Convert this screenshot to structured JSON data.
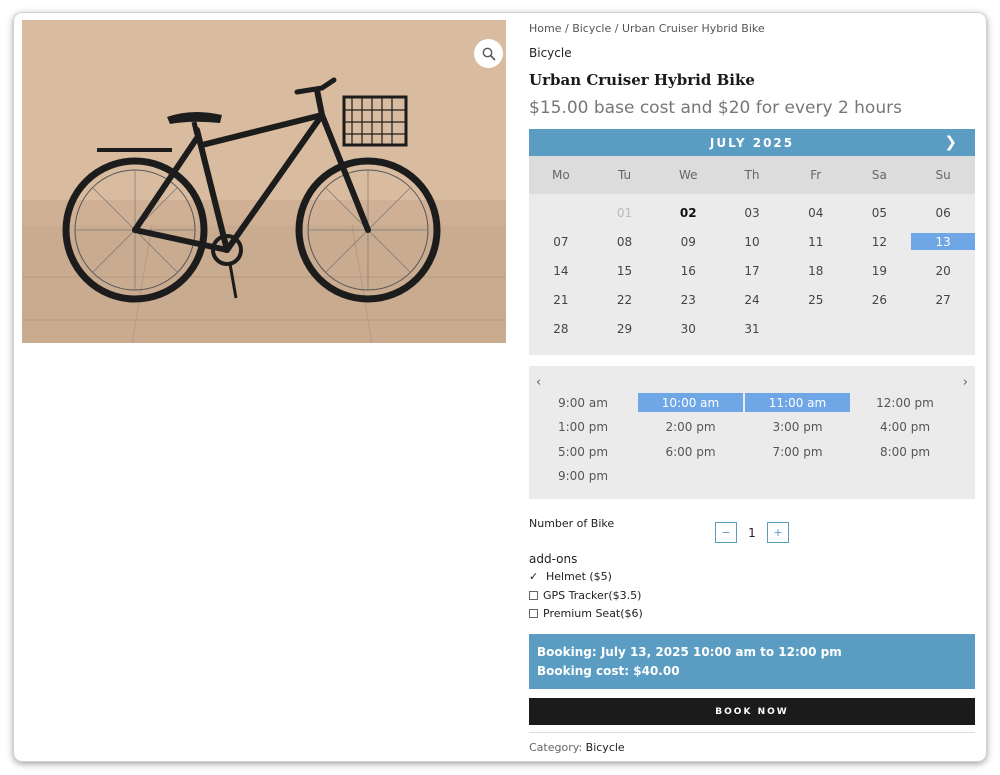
{
  "breadcrumb": {
    "home": "Home",
    "sep1": " / ",
    "category": "Bicycle",
    "sep2": " / ",
    "current": "Urban Cruiser Hybrid Bike"
  },
  "product": {
    "category_label": "Bicycle",
    "title": "Urban Cruiser Hybrid Bike",
    "price_text": "$15.00 base cost and $20 for every 2 hours"
  },
  "calendar": {
    "month": "JULY 2025",
    "next_icon": "chevron-right-icon",
    "weekdays": [
      "Mo",
      "Tu",
      "We",
      "Th",
      "Fr",
      "Sa",
      "Su"
    ],
    "days": [
      {
        "label": "",
        "state": "blank"
      },
      {
        "label": "01",
        "state": "off"
      },
      {
        "label": "02",
        "state": "today"
      },
      {
        "label": "03",
        "state": "normal"
      },
      {
        "label": "04",
        "state": "normal"
      },
      {
        "label": "05",
        "state": "normal"
      },
      {
        "label": "06",
        "state": "normal"
      },
      {
        "label": "07",
        "state": "normal"
      },
      {
        "label": "08",
        "state": "normal"
      },
      {
        "label": "09",
        "state": "normal"
      },
      {
        "label": "10",
        "state": "normal"
      },
      {
        "label": "11",
        "state": "normal"
      },
      {
        "label": "12",
        "state": "normal"
      },
      {
        "label": "13",
        "state": "selected"
      },
      {
        "label": "14",
        "state": "normal"
      },
      {
        "label": "15",
        "state": "normal"
      },
      {
        "label": "16",
        "state": "normal"
      },
      {
        "label": "17",
        "state": "normal"
      },
      {
        "label": "18",
        "state": "normal"
      },
      {
        "label": "19",
        "state": "normal"
      },
      {
        "label": "20",
        "state": "normal"
      },
      {
        "label": "21",
        "state": "normal"
      },
      {
        "label": "22",
        "state": "normal"
      },
      {
        "label": "23",
        "state": "normal"
      },
      {
        "label": "24",
        "state": "normal"
      },
      {
        "label": "25",
        "state": "normal"
      },
      {
        "label": "26",
        "state": "normal"
      },
      {
        "label": "27",
        "state": "normal"
      },
      {
        "label": "28",
        "state": "normal"
      },
      {
        "label": "29",
        "state": "normal"
      },
      {
        "label": "30",
        "state": "normal"
      },
      {
        "label": "31",
        "state": "normal"
      }
    ]
  },
  "times": {
    "prev_icon": "chevron-left-icon",
    "next_icon": "chevron-right-icon",
    "slots": [
      {
        "label": "9:00 am",
        "selected": false
      },
      {
        "label": "10:00 am",
        "selected": true
      },
      {
        "label": "11:00 am",
        "selected": true
      },
      {
        "label": "12:00 pm",
        "selected": false
      },
      {
        "label": "1:00 pm",
        "selected": false
      },
      {
        "label": "2:00 pm",
        "selected": false
      },
      {
        "label": "3:00 pm",
        "selected": false
      },
      {
        "label": "4:00 pm",
        "selected": false
      },
      {
        "label": "5:00 pm",
        "selected": false
      },
      {
        "label": "6:00 pm",
        "selected": false
      },
      {
        "label": "7:00 pm",
        "selected": false
      },
      {
        "label": "8:00 pm",
        "selected": false
      },
      {
        "label": "9:00 pm",
        "selected": false
      }
    ]
  },
  "quantity": {
    "label": "Number of Bike",
    "minus": "−",
    "value": "1",
    "plus": "+"
  },
  "addons": {
    "title": "add-ons",
    "items": [
      {
        "label": "Helmet ($5)",
        "checked": true
      },
      {
        "label": "GPS Tracker($3.5)",
        "checked": false
      },
      {
        "label": "Premium Seat($6)",
        "checked": false
      }
    ],
    "check_mark": "✓"
  },
  "summary": {
    "booking": "Booking: July 13, 2025 10:00 am to 12:00 pm",
    "cost": "Booking cost: $40.00"
  },
  "book_button": "BOOK NOW",
  "footer": {
    "category_label": "Category:",
    "category_value": "Bicycle"
  },
  "colors": {
    "accent": "#5b9cc3",
    "selected": "#6ea6e6",
    "dark_button": "#1b1b1b"
  }
}
